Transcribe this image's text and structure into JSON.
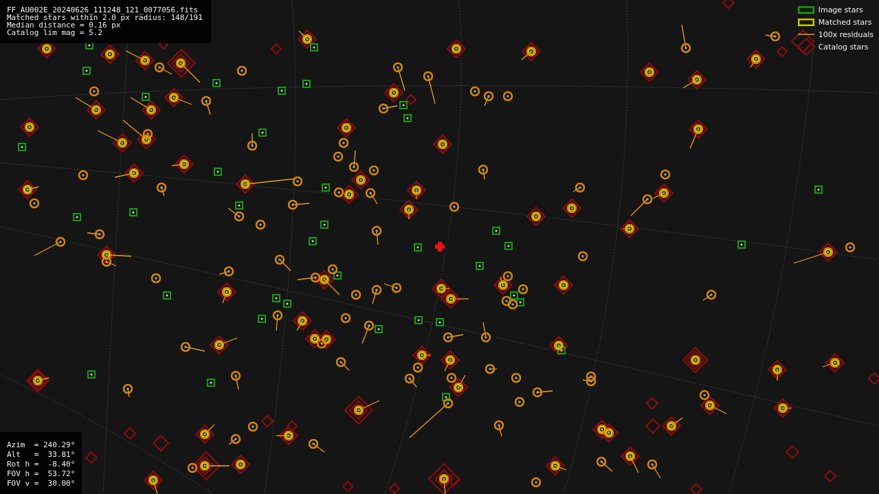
{
  "info_panel": {
    "lines": [
      "FF_AU002E_20240626_111248_121_0077056.fits",
      "Matched stars within 2.0 px radius: 148/191",
      "Median distance = 0.16 px",
      "Catalog lim mag = 5.2"
    ]
  },
  "legend": [
    {
      "kind": "image",
      "label": "Image stars"
    },
    {
      "kind": "matched",
      "label": "Matched stars"
    },
    {
      "kind": "residual",
      "label": "100x residuals"
    },
    {
      "kind": "catalog",
      "label": "Catalog stars"
    }
  ],
  "pointing_panel": {
    "lines": [
      "Azim  = 240.29°",
      "Alt   =  33.81°",
      "Rot h =  -8.40°",
      "FOV h =  53.72°",
      "FOV v =  30.00°"
    ]
  }
}
